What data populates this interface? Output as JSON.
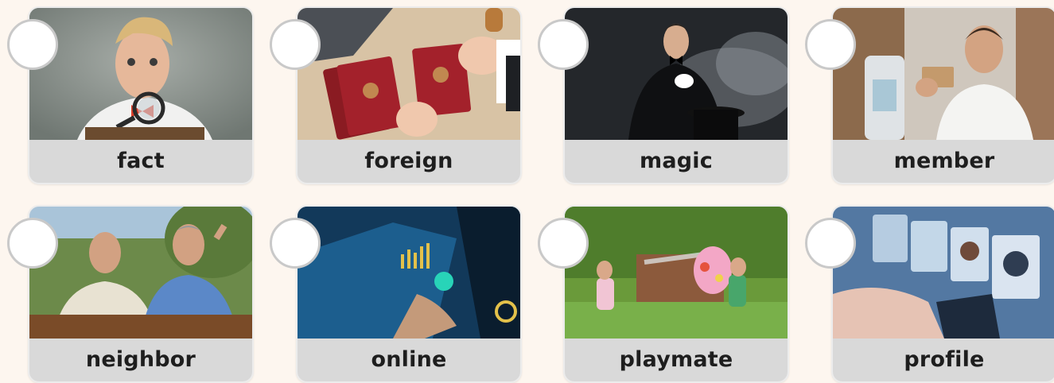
{
  "cards": [
    {
      "word": "fact"
    },
    {
      "word": "foreign"
    },
    {
      "word": "magic"
    },
    {
      "word": "member"
    },
    {
      "word": "neighbor"
    },
    {
      "word": "online"
    },
    {
      "word": "playmate"
    },
    {
      "word": "profile"
    }
  ],
  "colors": {
    "page_background": "#fdf6ef",
    "label_background": "#d9d9d9",
    "checkbox_fill": "#ffffff",
    "checkbox_border": "#c9c9c9"
  }
}
